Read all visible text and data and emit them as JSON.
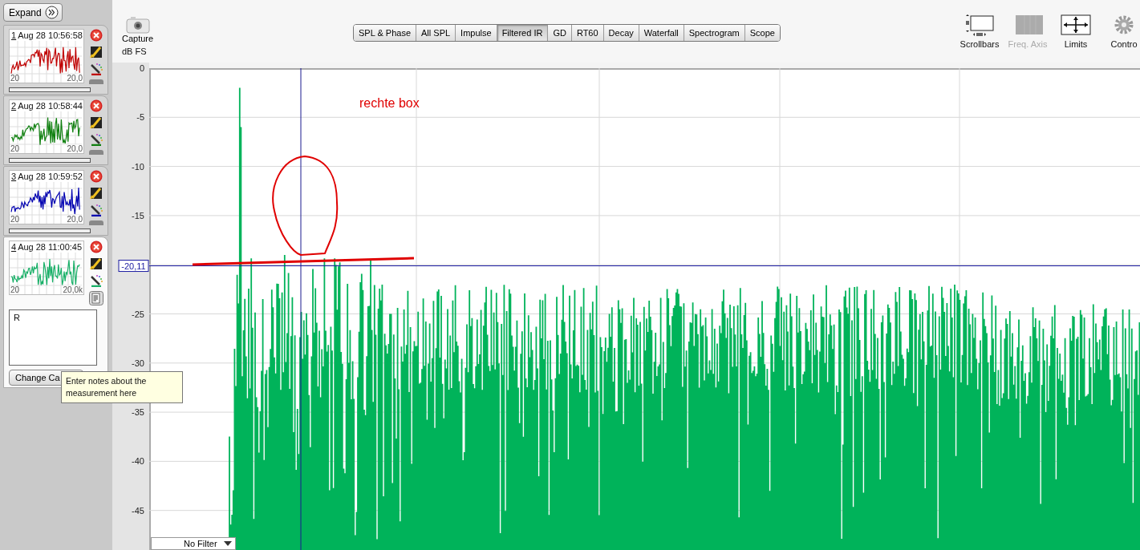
{
  "sidebar": {
    "expand_button": {
      "label": "Expand"
    },
    "measurements": [
      {
        "number": "1",
        "date": "Aug 28 10:56:58",
        "color": "#c00000",
        "selected": false,
        "axis_min": "20",
        "axis_max": "20,0"
      },
      {
        "number": "2",
        "date": "Aug 28 10:58:44",
        "color": "#108010",
        "selected": false,
        "axis_min": "20",
        "axis_max": "20,0"
      },
      {
        "number": "3",
        "date": "Aug 28 10:59:52",
        "color": "#0000b0",
        "selected": false,
        "axis_min": "20",
        "axis_max": "20,0"
      },
      {
        "number": "4",
        "date": "Aug 28 11:00:45",
        "color": "#19b068",
        "selected": true,
        "axis_min": "20",
        "axis_max": "20,0k",
        "notes": "R",
        "button": "Change Ca"
      }
    ],
    "tooltip": "Enter notes about the measurement here"
  },
  "toolbar": {
    "capture": "Capture",
    "tabs": [
      {
        "label": "SPL & Phase",
        "selected": false
      },
      {
        "label": "All SPL",
        "selected": false
      },
      {
        "label": "Impulse",
        "selected": false
      },
      {
        "label": "Filtered IR",
        "selected": true
      },
      {
        "label": "GD",
        "selected": false
      },
      {
        "label": "RT60",
        "selected": false
      },
      {
        "label": "Decay",
        "selected": false
      },
      {
        "label": "Waterfall",
        "selected": false
      },
      {
        "label": "Spectrogram",
        "selected": false
      },
      {
        "label": "Scope",
        "selected": false
      }
    ],
    "tools": [
      {
        "label": "Scrollbars",
        "kind": "scrollbars",
        "disabled": false
      },
      {
        "label": "Freq. Axis",
        "kind": "freq_axis",
        "disabled": true
      },
      {
        "label": "Limits",
        "kind": "limits",
        "disabled": false
      },
      {
        "label": "Contro",
        "kind": "controls",
        "disabled": false
      }
    ]
  },
  "plot": {
    "y_unit": "dB FS",
    "y_ticks": [
      "0",
      "-5",
      "-10",
      "-15",
      "-25",
      "-30",
      "-35",
      "-40",
      "-45"
    ],
    "cursor_reading": "-20,11",
    "annotation": "rechte box",
    "filter": "No Filter"
  }
}
